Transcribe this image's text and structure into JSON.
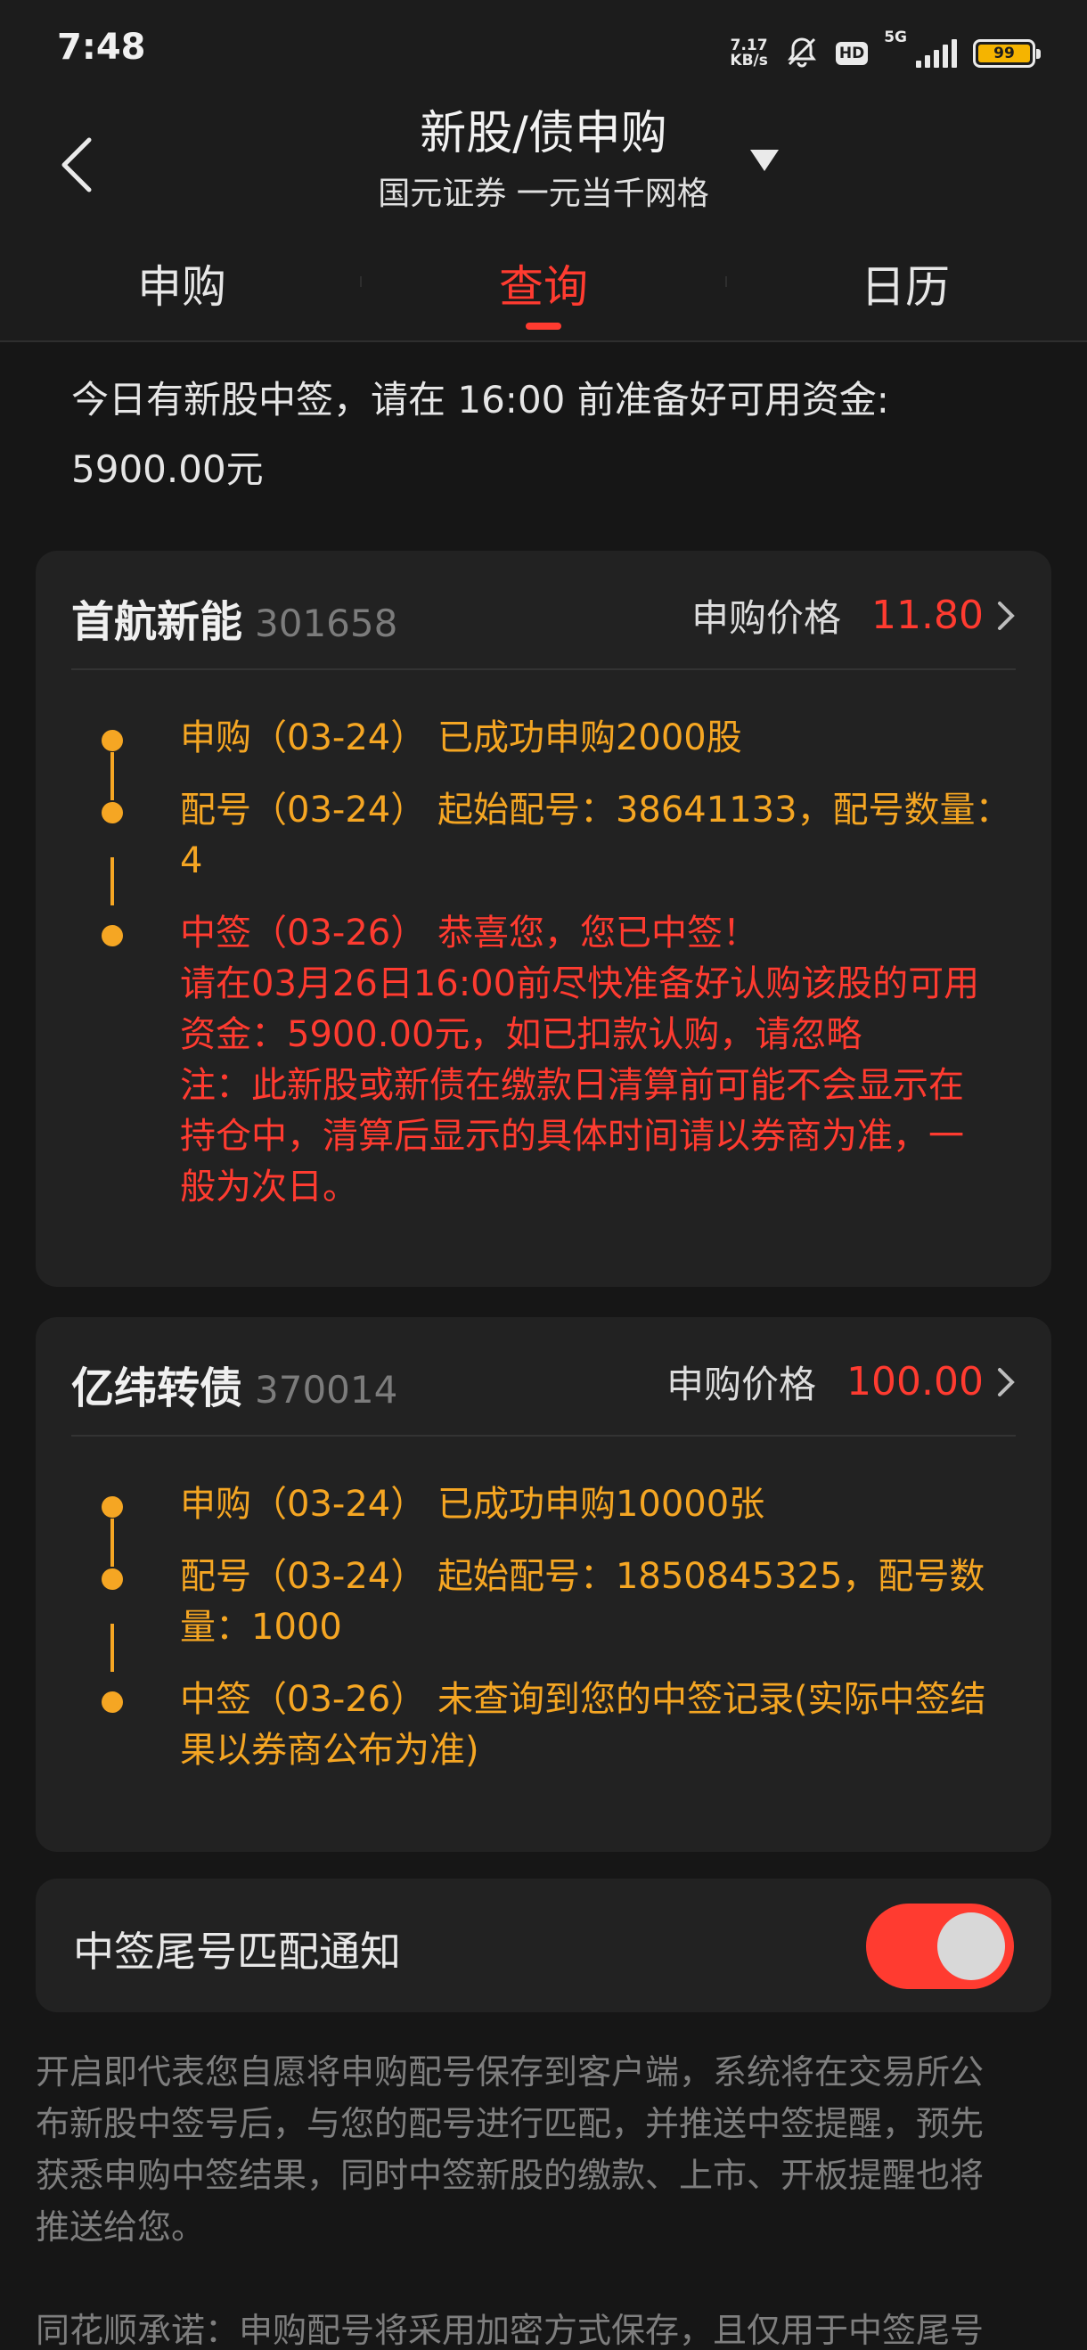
{
  "status_bar": {
    "time": "7:48",
    "net_speed_value": "7.17",
    "net_speed_unit": "KB/s",
    "hd": "HD",
    "network": "5G",
    "battery": "99"
  },
  "header": {
    "title": "新股/债申购",
    "subtitle": "国元证券 一元当千网格"
  },
  "tabs": [
    {
      "label": "申购"
    },
    {
      "label": "查询"
    },
    {
      "label": "日历"
    }
  ],
  "notice": {
    "line1": "今日有新股中签，请在 16:00 前准备好可用资金:",
    "line2": "5900.00元"
  },
  "cards": [
    {
      "name": "首航新能",
      "code": "301658",
      "price_label": "申购价格",
      "price": "11.80",
      "steps": [
        {
          "lines": [
            "申购（03-24） 已成功申购2000股"
          ]
        },
        {
          "lines": [
            "配号（03-24） 起始配号：38641133，配号数量：",
            "4"
          ]
        },
        {
          "lines": [
            "中签（03-26） 恭喜您，您已中签！",
            "请在03月26日16:00前尽快准备好认购该股的可用",
            "资金：5900.00元，如已扣款认购，请忽略",
            "注：此新股或新债在缴款日清算前可能不会显示在",
            "持仓中，清算后显示的具体时间请以券商为准，一",
            "般为次日。"
          ]
        }
      ]
    },
    {
      "name": "亿纬转债",
      "code": "370014",
      "price_label": "申购价格",
      "price": "100.00",
      "steps": [
        {
          "lines": [
            "申购（03-24） 已成功申购10000张"
          ]
        },
        {
          "lines": [
            "配号（03-24） 起始配号：1850845325，配号数",
            "量：1000"
          ]
        },
        {
          "lines": [
            "中签（03-26） 未查询到您的中签记录(实际中签结",
            "果以券商公布为准)"
          ]
        }
      ]
    }
  ],
  "notify": {
    "label": "中签尾号匹配通知",
    "enabled": true
  },
  "info": {
    "lines": [
      "开启即代表您自愿将申购配号保存到客户端，系统将在交易所公",
      "布新股中签号后，与您的配号进行匹配，并推送中签提醒，预先",
      "获悉申购中签结果，同时中签新股的缴款、上市、开板提醒也将",
      "推送给您。"
    ],
    "promise": "同花顺承诺：申购配号将采用加密方式保存，且仅用于中签尾号"
  },
  "colors": {
    "accent_red": "#ff3b30",
    "step_orange": "#f5a623",
    "background": "#161616",
    "card": "#222222"
  }
}
